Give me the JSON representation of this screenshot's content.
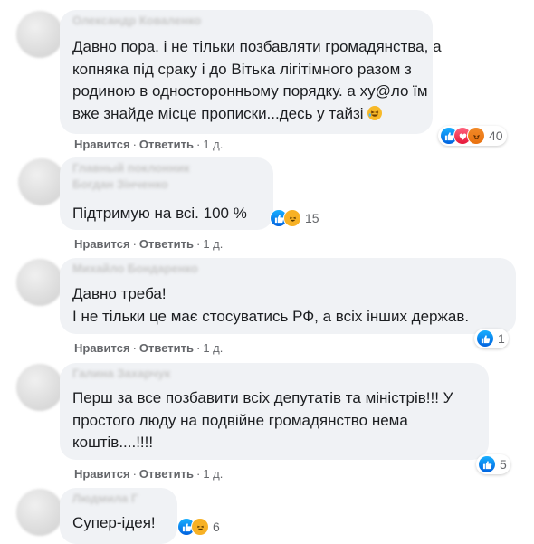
{
  "actions": {
    "like": "Нравится",
    "reply": "Ответить",
    "separator": "·"
  },
  "comments": [
    {
      "author": "Олександр Коваленко",
      "lines": [
        "Давно пора. і не тільки позбавляти громадянства, а",
        "копняка під сраку і до Вітька лігітімного разом з",
        "родиною в односторонньому порядку. а ху@ло їм",
        "вже знайде місце прописки...десь у тайзі"
      ],
      "time": "1 д.",
      "reactions": [
        "like-icon",
        "love-icon",
        "angry-icon"
      ],
      "reaction_count": "40"
    },
    {
      "badge": "Главный поклонник",
      "author": "Богдан Зінченко",
      "lines": [
        "Підтримую на всі. 100 %"
      ],
      "time": "1 д.",
      "reactions": [
        "like-icon",
        "haha-icon"
      ],
      "reaction_count": "15"
    },
    {
      "author": "Михайло Бондаренко",
      "lines": [
        "Давно треба!",
        "І не тільки це має стосуватись РФ, а всіх інших держав."
      ],
      "time": "1 д.",
      "reactions": [
        "like-icon"
      ],
      "reaction_count": "1"
    },
    {
      "author": "Галина Захарчук",
      "lines": [
        "Перш за все позбавити всіх депутатів та міністрів!!! У",
        "простого люду на подвійне громадянство нема",
        "коштів....!!!!"
      ],
      "time": "1 д.",
      "reactions": [
        "like-icon"
      ],
      "reaction_count": "5"
    },
    {
      "author": "Людмила Г",
      "lines": [
        "Супер-ідея!"
      ],
      "reactions": [
        "like-icon",
        "haha-icon"
      ],
      "reaction_count": "6"
    }
  ]
}
